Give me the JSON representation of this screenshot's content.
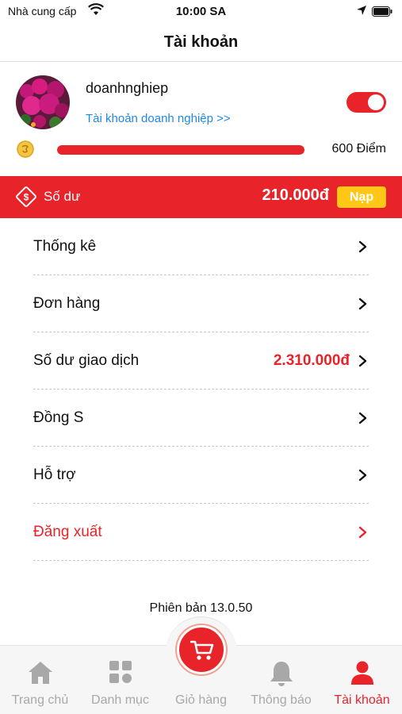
{
  "status_bar": {
    "carrier": "Nhà cung cấp",
    "time": "10:00 SA"
  },
  "header": {
    "title": "Tài khoản"
  },
  "profile": {
    "username": "doanhnghiep",
    "business_link": "Tài khoản doanh nghiệp >>",
    "toggle_on": true,
    "points_label": "600 Điểm",
    "points_progress": 1.0
  },
  "balance": {
    "label": "Số dư",
    "amount": "210.000đ",
    "topup_label": "Nạp"
  },
  "menu": {
    "items": [
      {
        "label": "Thống kê",
        "value": ""
      },
      {
        "label": "Đơn hàng",
        "value": ""
      },
      {
        "label": "Số dư giao dịch",
        "value": "2.310.000đ"
      },
      {
        "label": "Đồng S",
        "value": ""
      },
      {
        "label": "Hỗ trợ",
        "value": ""
      },
      {
        "label": "Đăng xuất",
        "value": ""
      }
    ]
  },
  "version": "Phiên bản 13.0.50",
  "tabbar": {
    "items": [
      {
        "label": "Trang chủ",
        "icon": "home-icon"
      },
      {
        "label": "Danh mục",
        "icon": "grid-icon"
      },
      {
        "label": "Giỏ hàng",
        "icon": "cart-icon"
      },
      {
        "label": "Thông báo",
        "icon": "bell-icon"
      },
      {
        "label": "Tài khoản",
        "icon": "user-icon",
        "active": true
      }
    ]
  },
  "colors": {
    "accent": "#e8232a",
    "link": "#1e88e5",
    "topup_button": "#ffc817",
    "inactive_tab": "#a8a8a8"
  }
}
